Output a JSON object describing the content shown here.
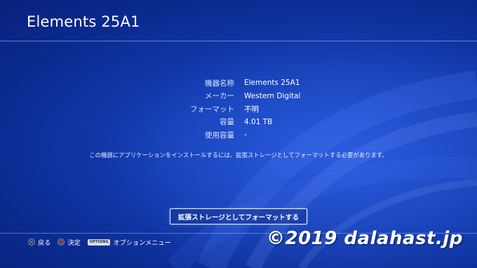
{
  "screen": {
    "title": "Elements 25A1"
  },
  "device_info": {
    "rows": [
      {
        "label": "機器名称",
        "value": "Elements 25A1"
      },
      {
        "label": "メーカー",
        "value": "Western Digital"
      },
      {
        "label": "フォーマット",
        "value": "不明"
      },
      {
        "label": "容量",
        "value": "4.01 TB"
      },
      {
        "label": "使用容量",
        "value": "-"
      }
    ]
  },
  "notice": "この機器にアプリケーションをインストールするには、拡張ストレージとしてフォーマットする必要があります。",
  "actions": {
    "format_label": "拡張ストレージとしてフォーマットする"
  },
  "footer": {
    "back_label": "戻る",
    "confirm_label": "決定",
    "options_key": "OPTIONS",
    "options_label": "オプションメニュー"
  },
  "watermark": "©2019 dalahast.jp",
  "icons": {
    "back": "cross-button-icon",
    "confirm": "circle-button-icon",
    "options": "options-button-icon"
  },
  "colors": {
    "background": "#133cb0",
    "cross_button": "#6f86d8",
    "circle_button": "#e0526b"
  }
}
